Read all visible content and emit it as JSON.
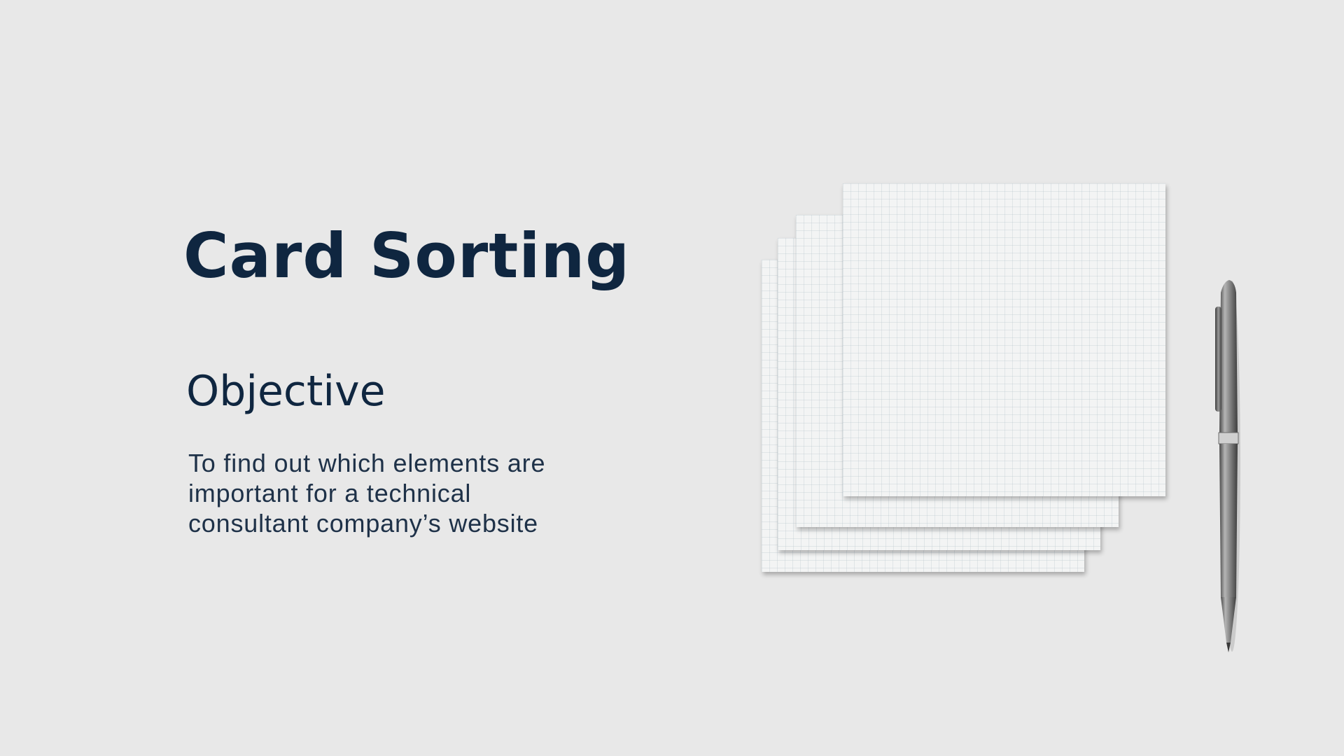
{
  "slide": {
    "title": "Card Sorting",
    "subtitle": "Objective",
    "body_lines": [
      "To find out which elements are",
      "important for a technical",
      "consultant company’s website"
    ]
  },
  "colors": {
    "background": "#e8e8e8",
    "heading": "#0f2640",
    "body_text": "#1e3148",
    "card": "#f3f4f4",
    "pen": "#7a7a7a"
  },
  "illustration": {
    "items": [
      "grid-paper-card",
      "grid-paper-card",
      "grid-paper-card",
      "grid-paper-card",
      "ballpoint-pen"
    ]
  }
}
